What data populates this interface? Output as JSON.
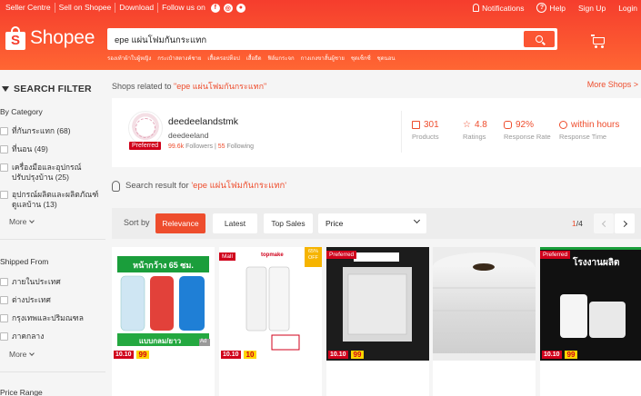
{
  "header": {
    "top_links": [
      "Seller Centre",
      "Sell on Shopee",
      "Download",
      "Follow us on"
    ],
    "social_icons": [
      "facebook-icon",
      "instagram-icon",
      "line-icon"
    ],
    "notifications": "Notifications",
    "help": "Help",
    "signup": "Sign Up",
    "login": "Login",
    "logo_text": "Shopee",
    "logo_letter": "S",
    "search_query": "epe แผ่นโฟมกันกระแทก",
    "suggestions": [
      "รองเท้าผ้าใบผู้หญิง",
      "กระเป๋าสตางค์ชาย",
      "เสื้อครอปท็อป",
      "เสื้อยืด",
      "ฟิล์มกระจก",
      "กางเกงขาสั้นผู้ชาย",
      "ชุดเซ็กซี่",
      "ชุดนอน"
    ]
  },
  "sidebar": {
    "title": "SEARCH FILTER",
    "by_category": "By Category",
    "categories": [
      "ที่กันกระแทก (68)",
      "ที่นอน (49)",
      "เครื่องมือและอุปกรณ์ปรับปรุงบ้าน (25)",
      "อุปกรณ์ผลิตและผลิตภัณฑ์ดูแลบ้าน (13)"
    ],
    "more": "More",
    "shipped_from": "Shipped From",
    "locations": [
      "ภายในประเทศ",
      "ต่างประเทศ",
      "กรุงเทพและปริมณฑล",
      "ภาคกลาง"
    ],
    "price_range": "Price Range"
  },
  "main": {
    "shops_related_prefix": "Shops related to ",
    "shops_related_kw": "\"epe แผ่นโฟมกันกระแทก\"",
    "more_shops": "More Shops >",
    "shop": {
      "name": "deedeelandstmk",
      "username": "deedeeland",
      "badge": "Preferred",
      "followers": "99.6k",
      "followers_label": " Followers | ",
      "following": "55",
      "following_label": " Following",
      "products": "301",
      "products_label": "Products",
      "ratings": "4.8",
      "ratings_label": "Ratings",
      "response_rate": "92%",
      "response_rate_label": "Response Rate",
      "response_time": "within hours",
      "response_time_label": "Response Time"
    },
    "result_prefix": "Search result for ",
    "result_kw": "'epe แผ่นโฟมกันกระแทก'",
    "sort": {
      "label": "Sort by",
      "relevance": "Relevance",
      "latest": "Latest",
      "top_sales": "Top Sales",
      "price": "Price",
      "page_current": "1",
      "page_total": "/4"
    },
    "products": [
      {
        "badge": "",
        "tag1": "10.10",
        "tag2": "99",
        "headline": "หน้ากว้าง 65 ซม.",
        "footer": "แบบกลม/ยาว",
        "ad": "Ad"
      },
      {
        "badge": "Mall",
        "tag1": "10.10",
        "tag2": "10",
        "brand": "topmake",
        "off": "65% OFF"
      },
      {
        "badge": "Preferred",
        "tag1": "10.10",
        "tag2": "99"
      },
      {
        "badge": "",
        "tag1": "",
        "tag2": ""
      },
      {
        "badge": "Preferred",
        "tag1": "10.10",
        "tag2": "99",
        "headline": "โรงงานผลิต"
      }
    ]
  },
  "colors": {
    "brand": "#ee4d2d",
    "header_start": "#f53d2d",
    "header_end": "#ff6633"
  }
}
